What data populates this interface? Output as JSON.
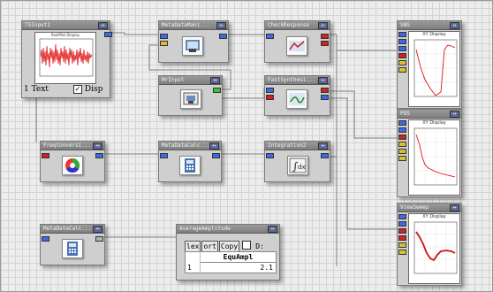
{
  "nodes": {
    "tsinput": {
      "title": "TSInput1",
      "text_label": "1 Text",
      "disp_label": "Disp",
      "plot_title": "RealPlot Display"
    },
    "meta_data_mani": {
      "title": "MetaDataMani..."
    },
    "check_response": {
      "title": "CheckResponse"
    },
    "mr_input": {
      "title": "MrInput"
    },
    "fast_synthesis": {
      "title": "FastSynthesi..."
    },
    "freq_conversion": {
      "title": "FreqConversi..."
    },
    "meta_data_calc_1": {
      "title": "MetaDataCalc..."
    },
    "integration": {
      "title": "Integration2"
    },
    "meta_data_calc_2": {
      "title": "MetaDataCalc..."
    },
    "average_amplitude": {
      "title": "AverageAmplitude",
      "buttons": [
        "lex",
        "ort",
        "Copy"
      ],
      "checkbox_label": "D:",
      "table_header": "EquAmpl",
      "row_index": "1",
      "row_value": "2.1"
    },
    "sns": {
      "title": "SNS",
      "plot_title": "XY Display"
    },
    "pds": {
      "title": "PDS",
      "plot_title": "XY Display"
    },
    "view_sweep": {
      "title": "ViewSweep",
      "plot_title": "XY Display"
    }
  },
  "colors": {
    "header": "#8a8a8a",
    "port_blue": "#3b6be0",
    "port_red": "#d02020",
    "trace": "#e01010"
  }
}
